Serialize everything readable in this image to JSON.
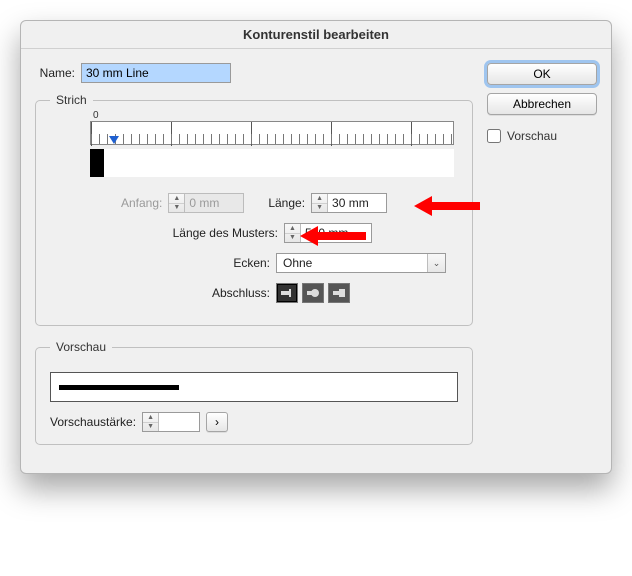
{
  "title": "Konturenstil bearbeiten",
  "name_label": "Name:",
  "name_value": "30 mm Line",
  "strich": {
    "legend": "Strich",
    "ruler_zero": "0",
    "anfang_label": "Anfang:",
    "anfang_value": "0 mm",
    "laenge_label": "Länge:",
    "laenge_value": "30 mm",
    "musterlaenge_label": "Länge des Musters:",
    "musterlaenge_value": "500 mm",
    "ecken_label": "Ecken:",
    "ecken_value": "Ohne",
    "abschluss_label": "Abschluss:"
  },
  "vorschau": {
    "legend": "Vorschau",
    "staerke_label": "Vorschaustärke:",
    "staerke_value": ""
  },
  "buttons": {
    "ok": "OK",
    "cancel": "Abbrechen"
  },
  "preview_checkbox": "Vorschau"
}
